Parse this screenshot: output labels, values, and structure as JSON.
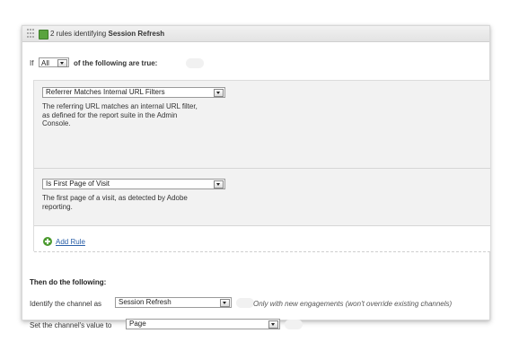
{
  "header": {
    "count_text": "2 rules identifying",
    "channel_name": "Session Refresh"
  },
  "condition": {
    "if_label": "If",
    "match_value": "All",
    "suffix": "of the following are true:"
  },
  "rules": [
    {
      "selected": "Referrer Matches Internal URL Filters",
      "description": [
        "The referring URL matches an internal URL filter,",
        "as defined for the report suite in the Admin",
        "Console."
      ]
    },
    {
      "selected": "Is First Page of Visit",
      "description": [
        "The first page of a visit, as detected by Adobe",
        "reporting."
      ]
    }
  ],
  "add_rule_label": "Add Rule",
  "then_label": "Then do the following:",
  "identify": {
    "label": "Identify the channel as",
    "value": "Session Refresh",
    "note": "Only with new engagements (won't override existing channels)"
  },
  "value_setting": {
    "label": "Set the channel's value to",
    "value": "Page"
  },
  "icons": {
    "grip": "grip-icon",
    "rule": "rule-icon",
    "dropdown": "chevron-down-icon",
    "add": "plus-circle-icon",
    "help": "help-icon"
  },
  "colors": {
    "link": "#2a5fa8",
    "add_icon": "#4b9a2f",
    "rule_icon": "#5aa33f",
    "rules_background": "#f2f2f2"
  }
}
